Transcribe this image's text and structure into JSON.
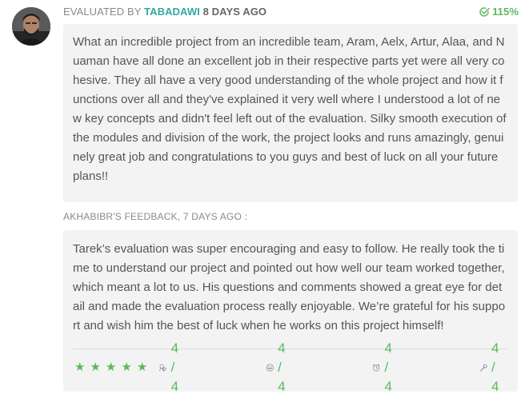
{
  "evaluation": {
    "evaluated_by_label": "EVALUATED BY",
    "evaluator_login": "TABADAWI",
    "time_ago": "8 DAYS AGO",
    "grade": "115%",
    "comment": "What an incredible project from an incredible team, Aram, Aelx, Artur, Alaa, and Nuaman have all done an excellent job in their respective parts yet were all very cohesive. They all have a very good understanding of the whole project and how it functions over all and they've explained it very well where I understood a lot of new key concepts and didn't feel left out of the evaluation. Silky smooth execution of the modules and division of the work, the project looks and runs amazingly, genuinely great job and congratulations to you guys and best of luck on all your future plans!!"
  },
  "feedback": {
    "header": "AKHABIBR'S FEEDBACK, 7 DAYS AGO :",
    "text": "Tarek’s evaluation was super encouraging and easy to follow. He really took the time to understand our project and pointed out how well our team worked together, which meant a lot to us. His questions and comments showed a great eye for detail and made the evaluation process really enjoyable. We’re grateful for his support and wish him the best of luck when he works on this project himself!",
    "stars": 5,
    "star_glyph": "★",
    "ratings": [
      {
        "icon": "nice-icon",
        "value": "4 / 4"
      },
      {
        "icon": "smiley-icon",
        "value": "4 / 4"
      },
      {
        "icon": "alarm-clock-icon",
        "value": "4 / 4"
      },
      {
        "icon": "hammer-icon",
        "value": "4 / 4"
      }
    ]
  },
  "colors": {
    "accent_green": "#5cb85c",
    "login_teal": "#2fa9a0",
    "bubble_bg": "#f3f3f3"
  }
}
